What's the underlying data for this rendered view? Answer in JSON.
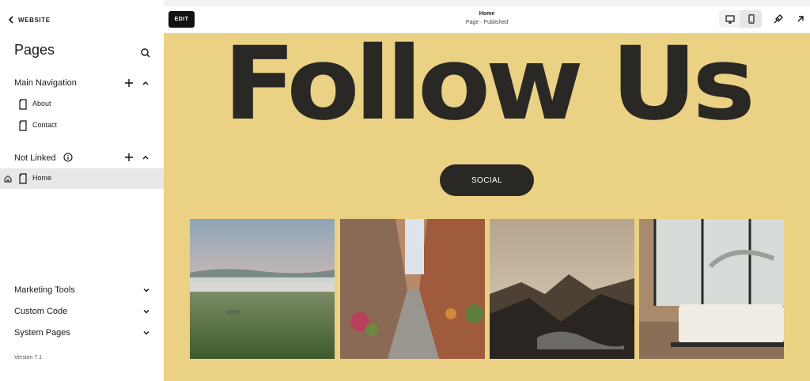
{
  "sidebar": {
    "back_label": "WEBSITE",
    "title": "Pages",
    "main_navigation": {
      "label": "Main Navigation",
      "items": [
        {
          "label": "About"
        },
        {
          "label": "Contact"
        }
      ]
    },
    "not_linked": {
      "label": "Not Linked",
      "items": [
        {
          "label": "Home",
          "is_homepage": true,
          "selected": true
        }
      ]
    },
    "footer_sections": [
      {
        "label": "Marketing Tools"
      },
      {
        "label": "Custom Code"
      },
      {
        "label": "System Pages"
      }
    ],
    "version": "Version 7.1"
  },
  "topbar": {
    "edit_label": "EDIT",
    "page_title": "Home",
    "page_status": "Page · Published",
    "device_selected": "desktop"
  },
  "preview": {
    "headline": "Follow Us",
    "button_label": "SOCIAL",
    "background_color": "#ebd183",
    "text_color": "#2a2824",
    "images": [
      {
        "subject": "misty meadow landscape"
      },
      {
        "subject": "narrow cobblestone alley with flowers"
      },
      {
        "subject": "mountain lake at dusk"
      },
      {
        "subject": "minimal bedroom with large window"
      }
    ]
  }
}
